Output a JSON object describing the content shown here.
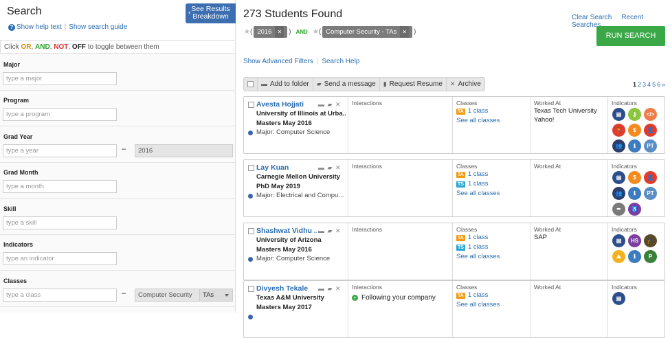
{
  "left": {
    "title": "Search",
    "help_text": "Show help text",
    "search_guide": "Show search guide",
    "see_results_line1": "See Results",
    "see_results_line2": "Breakdown",
    "toggle": {
      "prefix": "Click ",
      "or": "OR",
      "and": "AND",
      "not": "NOT",
      "off": "OFF",
      "suffix": " to toggle between them",
      "sep": ", "
    },
    "filters": [
      {
        "label": "Major",
        "placeholder": "type a major"
      },
      {
        "label": "Program",
        "placeholder": "type a program"
      },
      {
        "label": "Grad Year",
        "placeholder": "type a year",
        "value2": "2016"
      },
      {
        "label": "Grad Month",
        "placeholder": "type a month"
      },
      {
        "label": "Skill",
        "placeholder": "type a skill"
      },
      {
        "label": "Indicators",
        "placeholder": "type an indicator"
      },
      {
        "label": "Classes",
        "placeholder": "type a class",
        "value2": "Computer Security",
        "select": "TAs"
      }
    ]
  },
  "main": {
    "count": "273 Students Found",
    "clear_search": "Clear Search",
    "recent_searches": "Recent Searches",
    "run_search": "RUN SEARCH",
    "chip1": "2016",
    "chip2": "Computer Security - TAs",
    "and": "AND",
    "advanced": "Show Advanced Filters",
    "search_help": "Search Help",
    "toolbar": {
      "folder": "Add to folder",
      "message": "Send a message",
      "resume": "Request Resume",
      "archive": "Archive"
    },
    "pages": {
      "current": "1",
      "others": [
        "2",
        "3",
        "4",
        "5",
        "6"
      ],
      "next": "»"
    },
    "col_headers": {
      "interactions": "Interactions",
      "classes": "Classes",
      "worked": "Worked At",
      "indicators": "Indicators"
    },
    "students": [
      {
        "name": "Avesta Hojjati",
        "uni": "University of Illinois at Urba...",
        "degree": "Masters May 2016",
        "major": "Major: Computer Science",
        "interaction": "",
        "classes": [
          {
            "tag": "TA",
            "color": "#f39c12",
            "text": "1 class"
          }
        ],
        "see_all": "See all classes",
        "worked": [
          "Texas Tech University",
          "Yahoo!"
        ],
        "indicators": [
          {
            "icon": "book-icon",
            "color": "#2c4f8c",
            "g": "▤"
          },
          {
            "icon": "key-icon",
            "color": "#8cc63f",
            "g": "⚷"
          },
          {
            "icon": "code-icon",
            "color": "#f07e4c",
            "g": "</>"
          },
          {
            "icon": "runner-icon",
            "color": "#e03c2e",
            "g": "🏃"
          },
          {
            "icon": "dollar-icon",
            "color": "#f58b1f",
            "g": "$"
          },
          {
            "icon": "person-icon",
            "color": "#e03c2e",
            "g": "👤"
          },
          {
            "icon": "group-icon",
            "color": "#2c3e6b",
            "g": "👥"
          },
          {
            "icon": "info-icon",
            "color": "#3d7cbf",
            "g": "ℹ"
          },
          {
            "icon": "pt-icon",
            "color": "#5b8ec5",
            "g": "PT"
          }
        ]
      },
      {
        "name": "Lay Kuan",
        "uni": "Carnegie Mellon University",
        "degree": "PhD May 2019",
        "major": "Major: Electrical and Compu...",
        "interaction": "",
        "classes": [
          {
            "tag": "TA",
            "color": "#f39c12",
            "text": "1 class"
          },
          {
            "tag": "TS",
            "color": "#2aa7d4",
            "text": "1 class"
          }
        ],
        "see_all": "See all classes",
        "worked": [],
        "indicators": [
          {
            "icon": "book-icon",
            "color": "#2c4f8c",
            "g": "▤"
          },
          {
            "icon": "dollar-icon",
            "color": "#f58b1f",
            "g": "$"
          },
          {
            "icon": "person-icon",
            "color": "#e03c2e",
            "g": "👤"
          },
          {
            "icon": "group-icon",
            "color": "#2c3e6b",
            "g": "👥"
          },
          {
            "icon": "info-icon",
            "color": "#3d7cbf",
            "g": "ℹ"
          },
          {
            "icon": "pt-icon",
            "color": "#5b8ec5",
            "g": "PT"
          },
          {
            "icon": "pen-icon",
            "color": "#7a7a7a",
            "g": "✒"
          },
          {
            "icon": "accessibility-icon",
            "color": "#7b3fa0",
            "g": "♿"
          }
        ]
      },
      {
        "name": "Shashwat Vidhu ...",
        "uni": "University of Arizona",
        "degree": "Masters May 2016",
        "major": "Major: Computer Science",
        "interaction": "",
        "classes": [
          {
            "tag": "TA",
            "color": "#f39c12",
            "text": "1 class"
          },
          {
            "tag": "TS",
            "color": "#2aa7d4",
            "text": "1 class"
          }
        ],
        "see_all": "See all classes",
        "worked": [
          "SAP"
        ],
        "indicators": [
          {
            "icon": "book-icon",
            "color": "#2c4f8c",
            "g": "▤"
          },
          {
            "icon": "hs-icon",
            "color": "#7b3fa0",
            "g": "HS"
          },
          {
            "icon": "graduation-icon",
            "color": "#5a4a2a",
            "g": "🎓"
          },
          {
            "icon": "mountain-icon",
            "color": "#f5b21f",
            "g": "⛰"
          },
          {
            "icon": "info-icon",
            "color": "#3d7cbf",
            "g": "ℹ"
          },
          {
            "icon": "p-icon",
            "color": "#3a7f3a",
            "g": "P"
          }
        ]
      },
      {
        "name": "Divyesh Tekale",
        "uni": "Texas A&M University",
        "degree": "Masters May 2017",
        "major": "",
        "interaction": "Following your company",
        "classes": [
          {
            "tag": "TA",
            "color": "#f39c12",
            "text": "1 class"
          }
        ],
        "see_all": "See all classes",
        "worked": [],
        "indicators": [
          {
            "icon": "book-icon",
            "color": "#2c4f8c",
            "g": "▤"
          }
        ]
      }
    ]
  }
}
